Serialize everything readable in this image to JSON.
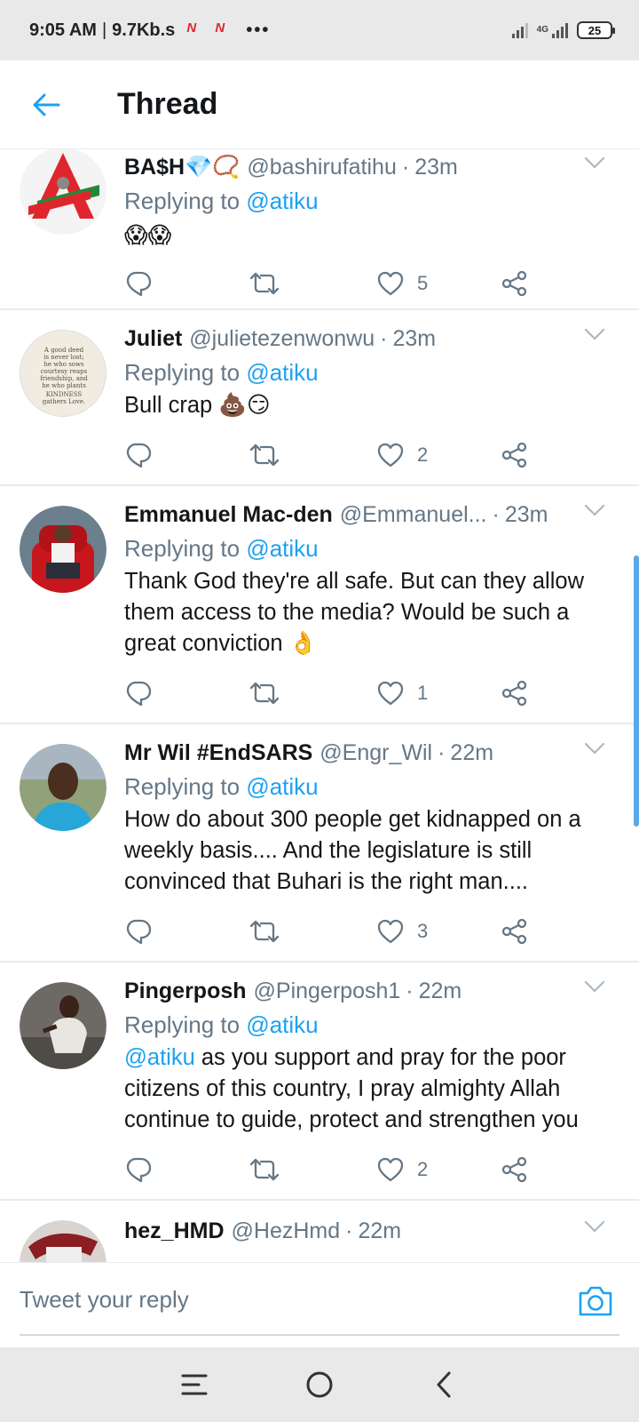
{
  "status_bar": {
    "time": "9:05 AM",
    "speed": "9.7Kb.s",
    "network": "4G",
    "battery": "25"
  },
  "header": {
    "title": "Thread"
  },
  "reply_prefix": "Replying to",
  "tweets": [
    {
      "name": "BA$H💎📿",
      "handle": "@bashirufatihu",
      "time": "23m",
      "replying_to": "@atiku",
      "mention": "",
      "text": "😱😱",
      "likes": "5"
    },
    {
      "name": "Juliet",
      "handle": "@julietezenwonwu",
      "time": "23m",
      "replying_to": "@atiku",
      "mention": "",
      "text": "Bull crap 💩😏",
      "likes": "2"
    },
    {
      "name": "Emmanuel Mac-den",
      "handle": "@Emmanuel...",
      "time": "23m",
      "replying_to": "@atiku",
      "mention": "",
      "text": "Thank God they're all safe. But can they allow them access to the media? Would be such a great conviction 👌",
      "likes": "1"
    },
    {
      "name": "Mr Wil #EndSARS",
      "handle": "@Engr_Wil",
      "time": "22m",
      "replying_to": "@atiku",
      "mention": "",
      "text": "How do about 300 people get kidnapped on a weekly basis.... And the legislature is still convinced that Buhari is the right man....",
      "likes": "3"
    },
    {
      "name": "Pingerposh",
      "handle": "@Pingerposh1",
      "time": "22m",
      "replying_to": "@atiku",
      "mention": "@atiku",
      "text": " as you support and pray for the poor citizens of this country, I pray almighty Allah continue to guide, protect and strengthen you",
      "likes": "2"
    },
    {
      "name": "hez_HMD",
      "handle": "@HezHmd",
      "time": "22m",
      "replying_to": "",
      "mention": "",
      "text": "",
      "likes": ""
    }
  ],
  "reply_box": {
    "placeholder": "Tweet your reply"
  },
  "colors": {
    "accent": "#1da1f2",
    "muted": "#657786",
    "text": "#14171a"
  },
  "icons": [
    "back-arrow-icon",
    "chevron-down-icon",
    "reply-icon",
    "retweet-icon",
    "like-icon",
    "share-icon",
    "camera-icon",
    "menu-icon",
    "home-icon",
    "back-icon"
  ]
}
